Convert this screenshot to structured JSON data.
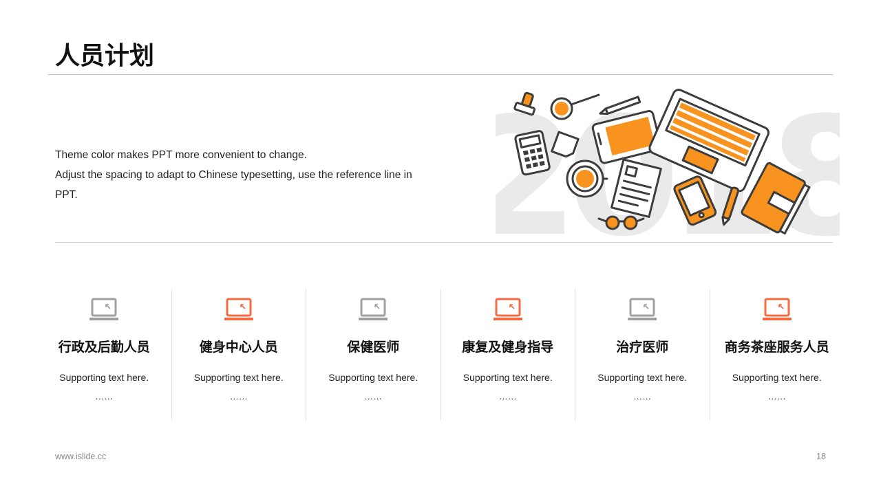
{
  "page": {
    "title": "人员计划"
  },
  "intro": {
    "line1": "Theme color makes PPT more convenient to change.",
    "line2": "Adjust the spacing to adapt to Chinese typesetting, use the reference line in PPT."
  },
  "hero": {
    "year": "2018",
    "icon": "office-desk-illustration"
  },
  "colors": {
    "accent_orange": "#F7931E",
    "accent_red": "#F26B43",
    "icon_gray": "#A0A0A0",
    "outline": "#3C3C3C",
    "watermark": "#EAEAEA"
  },
  "cards": [
    {
      "name": "行政及后勤人员",
      "support": "Supporting text here.",
      "dots": "……",
      "icon": "laptop-icon",
      "icon_color": "#A0A0A0"
    },
    {
      "name": "健身中心人员",
      "support": "Supporting text here.",
      "dots": "……",
      "icon": "laptop-icon",
      "icon_color": "#F26B43"
    },
    {
      "name": "保健医师",
      "support": "Supporting text here.",
      "dots": "……",
      "icon": "laptop-icon",
      "icon_color": "#A0A0A0"
    },
    {
      "name": "康复及健身指导",
      "support": "Supporting text here.",
      "dots": "……",
      "icon": "laptop-icon",
      "icon_color": "#F26B43"
    },
    {
      "name": "治疗医师",
      "support": "Supporting text here.",
      "dots": "……",
      "icon": "laptop-icon",
      "icon_color": "#A0A0A0"
    },
    {
      "name": "商务茶座服务人员",
      "support": "Supporting text here.",
      "dots": "……",
      "icon": "laptop-icon",
      "icon_color": "#F26B43"
    }
  ],
  "footer": {
    "website": "www.islide.cc",
    "page_number": "18"
  }
}
